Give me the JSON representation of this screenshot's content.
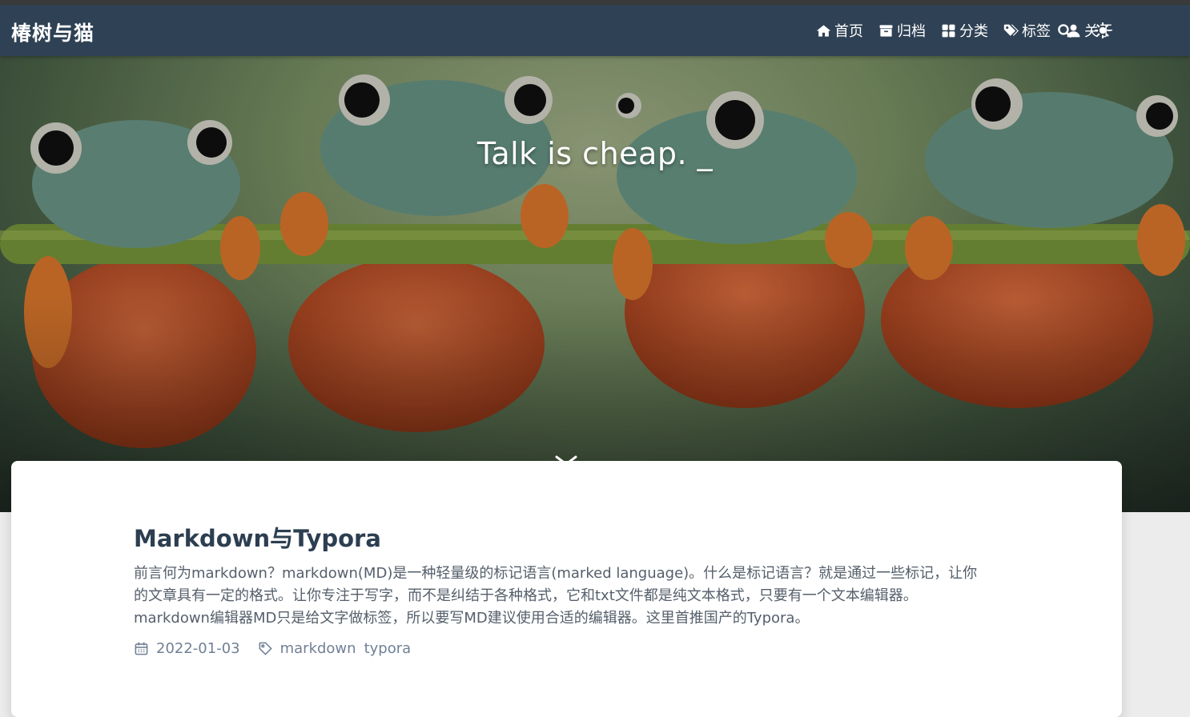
{
  "brand": "椿树与猫",
  "nav": {
    "items": [
      {
        "label": "首页",
        "icon": "home-icon"
      },
      {
        "label": "归档",
        "icon": "archive-icon"
      },
      {
        "label": "分类",
        "icon": "category-icon"
      },
      {
        "label": "标签",
        "icon": "tags-icon"
      },
      {
        "label": "关于",
        "icon": "user-icon"
      }
    ],
    "search_icon": "search-icon",
    "theme_icon": "sun-icon"
  },
  "banner": {
    "slogan": "Talk is cheap. _"
  },
  "post": {
    "title": "Markdown与Typora",
    "excerpt": "前言何为markdown？markdown(MD)是一种轻量级的标记语言(marked language)。什么是标记语言？就是通过一些标记，让你的文章具有一定的格式。让你专注于写字，而不是纠结于各种格式，它和txt文件都是纯文本格式，只要有一个文本编辑器。 markdown编辑器MD只是给文字做标签，所以要写MD建议使用合适的编辑器。这里首推国产的Typora。",
    "date": "2022-01-03",
    "tags": [
      "markdown",
      "typora"
    ]
  },
  "colors": {
    "navbar": "#2f4154",
    "title": "#2c3e50",
    "meta": "#718096"
  }
}
